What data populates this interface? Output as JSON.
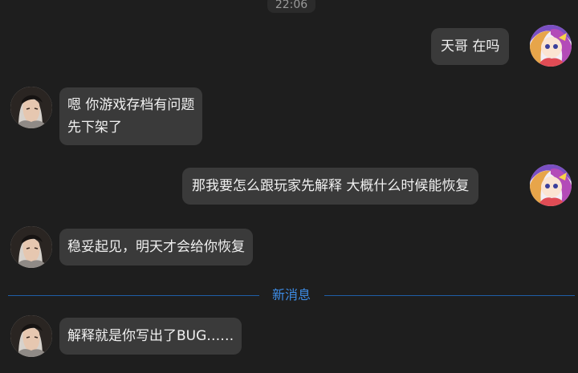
{
  "timestamp": "22:06",
  "messages": [
    {
      "side": "right",
      "lines": [
        "天哥  在吗"
      ]
    },
    {
      "side": "left",
      "lines": [
        "嗯 你游戏存档有问题",
        "先下架了"
      ]
    },
    {
      "side": "right",
      "lines": [
        "那我要怎么跟玩家先解释  大概什么时候能恢复"
      ]
    },
    {
      "side": "left",
      "lines": [
        "稳妥起见，明天才会给你恢复"
      ]
    },
    {
      "side": "left",
      "lines": [
        "解释就是你写出了BUG……"
      ]
    }
  ],
  "new_messages_divider": "新消息",
  "avatars": {
    "self": "anime-girl-avatar",
    "contact": "warrior-avatar"
  },
  "colors": {
    "background": "#1e1e1e",
    "bubble": "#3a3a3a",
    "divider_accent": "#3d8ce6"
  }
}
